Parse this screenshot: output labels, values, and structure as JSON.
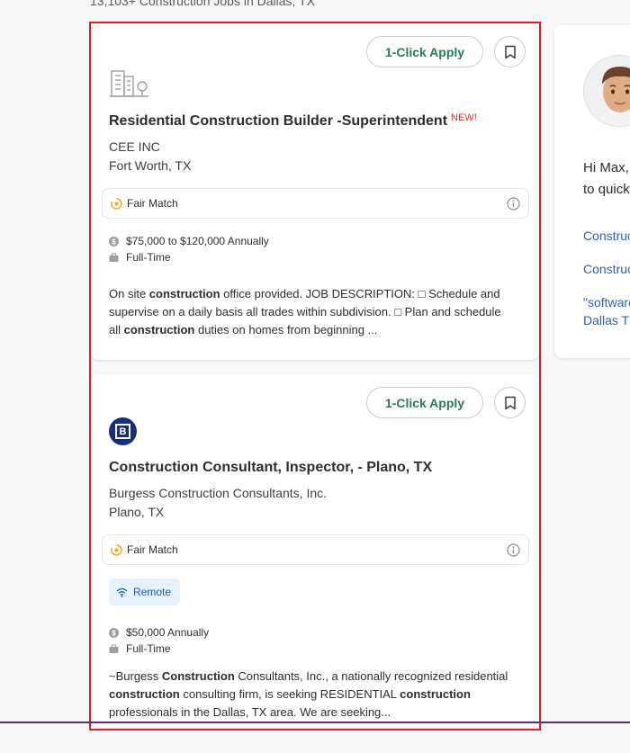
{
  "header": {
    "results_count": "13,103+ Construction Jobs in Dallas, TX"
  },
  "jobs": [
    {
      "apply_label": "1-Click Apply",
      "title": "Residential Construction Builder -Superintendent",
      "badge": "NEW!",
      "company": "CEE INC",
      "location": "Fort Worth, TX",
      "match": "Fair Match",
      "salary": "$75,000 to $120,000 Annually",
      "job_type": "Full-Time",
      "snippet": [
        {
          "t": "On site "
        },
        {
          "t": "construction",
          "b": true
        },
        {
          "t": " office provided. JOB DESCRIPTION: □ Schedule and supervise on a daily basis all trades within subdivision. □ Plan and schedule all "
        },
        {
          "t": "construction",
          "b": true
        },
        {
          "t": " duties on homes from beginning ..."
        }
      ]
    },
    {
      "apply_label": "1-Click Apply",
      "title": "Construction Consultant, Inspector, - Plano, TX",
      "company": "Burgess Construction Consultants, Inc.",
      "location": "Plano, TX",
      "match": "Fair Match",
      "remote_label": "Remote",
      "salary": "$50,000 Annually",
      "job_type": "Full-Time",
      "snippet": [
        {
          "t": "~Burgess "
        },
        {
          "t": "Construction",
          "b": true
        },
        {
          "t": " Consultants, Inc., a nationally recognized residential "
        },
        {
          "t": "construction",
          "b": true
        },
        {
          "t": " consulting firm, is seeking RESIDENTIAL "
        },
        {
          "t": "construction",
          "b": true
        },
        {
          "t": " professionals in the Dallas, TX area. We are seeking..."
        }
      ]
    }
  ],
  "profile": {
    "greeting_line1": "Hi Max,",
    "greeting_line2": "to quick",
    "recent_searches": [
      "Construc",
      "Construc",
      "\"software",
      "Dallas T"
    ]
  },
  "icons": {
    "building": "building-placeholder-icon",
    "bookmark": "bookmark-icon",
    "match": "fair-match-icon",
    "info": "info-icon",
    "salary": "dollar-icon",
    "briefcase": "briefcase-icon",
    "remote": "wifi-icon"
  },
  "colors": {
    "apply_text": "#2a7a57",
    "new_badge": "#e0322d",
    "link": "#2c62b4",
    "feed_border": "#e01b24",
    "company_logo": "#14307a"
  }
}
